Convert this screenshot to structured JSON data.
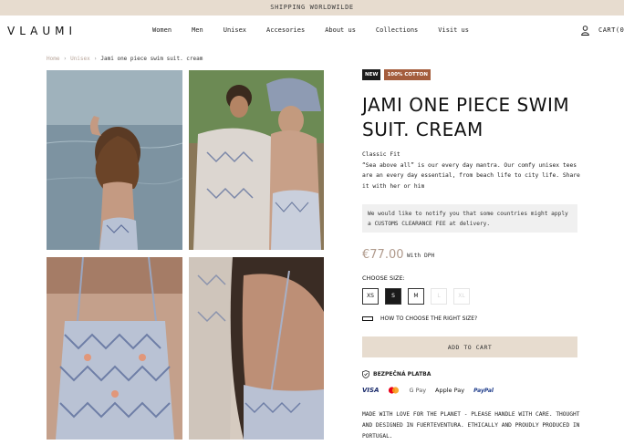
{
  "topbar": {
    "text": "SHIPPING WORLDWILDE"
  },
  "header": {
    "logo": "VLAUMI",
    "nav": [
      "Women",
      "Men",
      "Unisex",
      "Accesories",
      "About us",
      "Collections",
      "Visit us"
    ],
    "cart_label": "CART(0)"
  },
  "breadcrumb": {
    "home": "Home",
    "section": "Unisex",
    "current": "Jami one piece swim suit. cream"
  },
  "product": {
    "badges": [
      "NEW",
      "100% COTTON"
    ],
    "title": "JAMI ONE PIECE SWIM SUIT. CREAM",
    "fit": "Classic Fit",
    "description": "“Sea above all” is our every day mantra. Our comfy unisex tees are an every day essential, from beach life to city life. Share it with her or him",
    "notice": "We would like to notify you that some countries might apply a CUSTOMS CLEARANCE FEE at delivery.",
    "price": "€77.00",
    "price_note": "With DPH",
    "size_label": "CHOOSE SIZE:",
    "sizes": [
      "XS",
      "S",
      "M",
      "L",
      "XL"
    ],
    "selected_size": "S",
    "size_guide": "HOW TO CHOOSE THE RIGHT SIZE?",
    "add_to_cart": "ADD TO CART",
    "secure_label": "BEZPEČNÁ PLATBA",
    "payments": [
      "VISA",
      "Mastercard",
      "G Pay",
      "Apple Pay",
      "PayPal"
    ],
    "footer_text": "MADE WITH LOVE FOR THE PLANET - PLEASE HANDLE WITH CARE. THOUGHT AND DESIGNED IN FUERTEVENTURA. ETHICALLY AND PROUDLY PRODUCED IN PORTUGAL."
  },
  "colors": {
    "accent": "#e7dccf",
    "price": "#b09a8c",
    "badge_cotton": "#a45d3d",
    "breadcrumb": "#b8a59a"
  }
}
